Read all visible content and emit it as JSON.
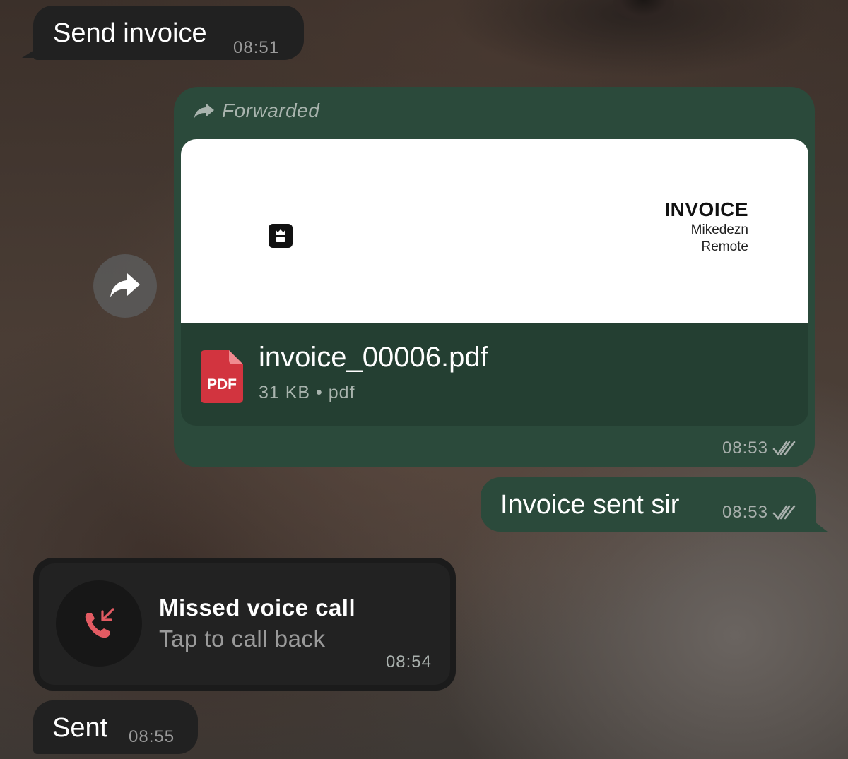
{
  "messages": {
    "m1": {
      "text": "Send invoice",
      "time": "08:51"
    },
    "forwarded": {
      "label": "Forwarded",
      "preview": {
        "title": "INVOICE",
        "name": "Mikedezn",
        "location": "Remote"
      },
      "file": {
        "icon_label": "PDF",
        "name": "invoice_00006.pdf",
        "meta": "31 KB • pdf"
      },
      "time": "08:53"
    },
    "m3": {
      "text": "Invoice sent sir",
      "time": "08:53"
    },
    "missed_call": {
      "title": "Missed voice call",
      "subtitle": "Tap to call back",
      "time": "08:54"
    },
    "m5": {
      "text": "Sent",
      "time": "08:55"
    }
  },
  "colors": {
    "incoming_bubble": "#212121",
    "outgoing_bubble": "#2b4a3b",
    "pdf_red": "#d2343f",
    "missed_call_red": "#e35b63"
  }
}
